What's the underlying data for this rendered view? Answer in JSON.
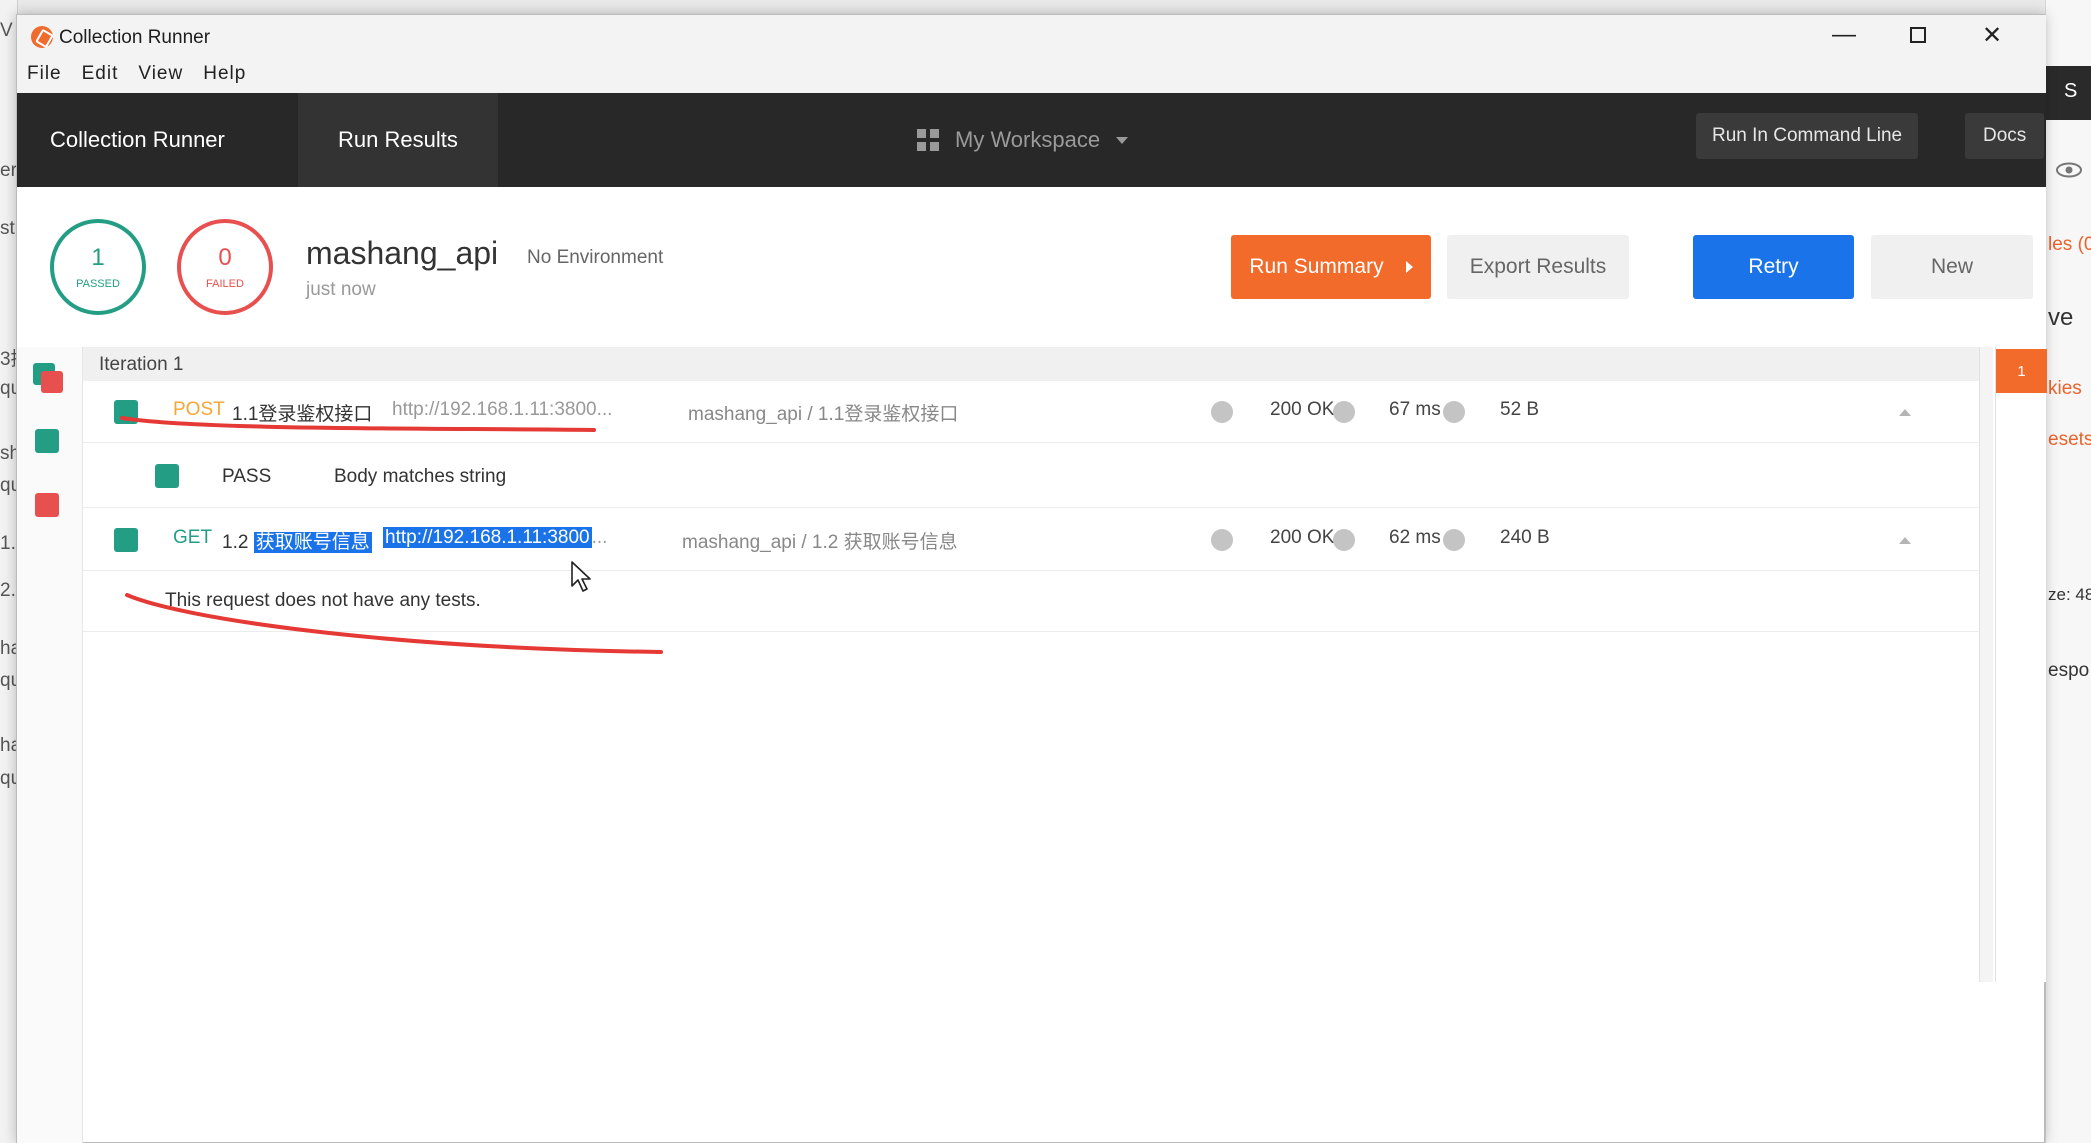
{
  "window": {
    "title": "Collection Runner",
    "menu": [
      "File",
      "Edit",
      "View",
      "Help"
    ]
  },
  "nav": {
    "tabs": [
      "Collection Runner",
      "Run Results"
    ],
    "workspace": "My Workspace",
    "run_command_line": "Run In Command Line",
    "docs": "Docs"
  },
  "summary": {
    "passed_count": "1",
    "passed_label": "PASSED",
    "failed_count": "0",
    "failed_label": "FAILED",
    "collection_name": "mashang_api",
    "environment": "No Environment",
    "time": "just now",
    "buttons": {
      "run_summary": "Run Summary",
      "export": "Export Results",
      "retry": "Retry",
      "new": "New"
    }
  },
  "results": {
    "iteration_label": "Iteration 1",
    "iteration_badge": "1",
    "requests": [
      {
        "method": "POST",
        "name": "1.1登录鉴权接口",
        "url": "http://192.168.1.11:3800...",
        "path": "mashang_api / 1.1登录鉴权接口",
        "status": "200 OK",
        "time": "67 ms",
        "size": "52 B",
        "tests": [
          {
            "result": "PASS",
            "name": "Body matches string"
          }
        ]
      },
      {
        "method": "GET",
        "name_prefix": "1.2",
        "name_selected": "获取账号信息",
        "url_selected": "http://192.168.1.11:3800",
        "url_suffix": "...",
        "path": "mashang_api / 1.2 获取账号信息",
        "status": "200 OK",
        "time": "62 ms",
        "size": "240 B",
        "no_tests_message": "This request does not have any tests."
      }
    ]
  },
  "background": {
    "left_fragments": [
      "V",
      "er",
      "st",
      "3接",
      "qu",
      "sh",
      "qu",
      "1.",
      "2.",
      "ha",
      "qu",
      "ha",
      "qu"
    ],
    "right_fragments": [
      "S",
      "les (0",
      "ve",
      "kies",
      "esets",
      "ze: 48",
      "espo"
    ]
  },
  "colors": {
    "accent_orange": "#f26b2b",
    "pass_green": "#239e84",
    "fail_red": "#e84f4f",
    "retry_blue": "#1a73e8",
    "annotation_red": "#e53935"
  }
}
